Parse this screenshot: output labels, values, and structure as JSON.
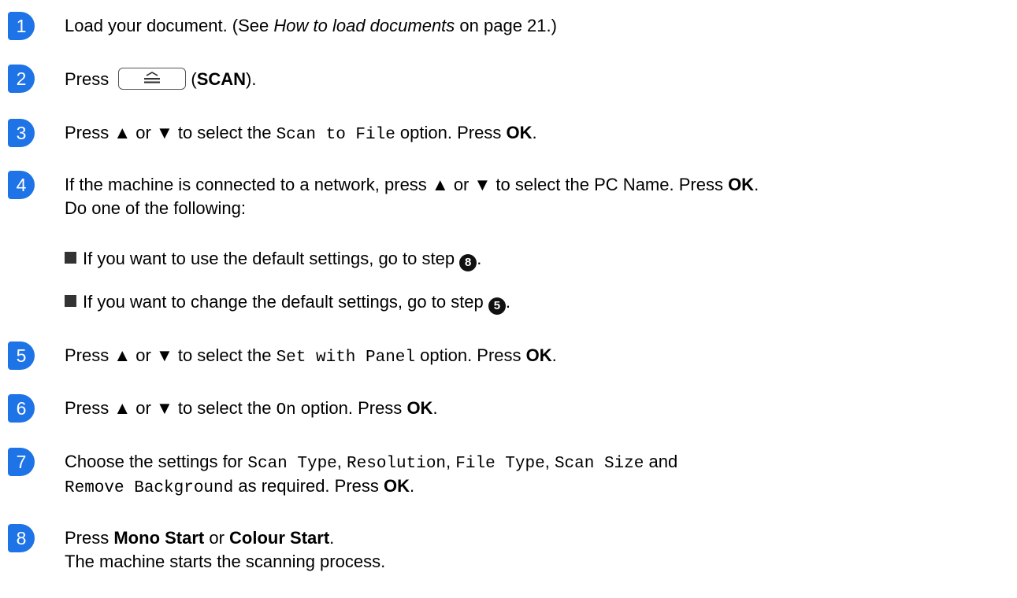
{
  "steps": [
    {
      "num": "1",
      "text_a": "Load your document. (See ",
      "ref_italic": "How to load documents",
      "text_b": " on page 21.)"
    },
    {
      "num": "2",
      "press": "Press",
      "key_label": "SCAN",
      "paren_open": "(",
      "paren_close": ")."
    },
    {
      "num": "3",
      "a": "Press ",
      "up": "▲",
      "or": " or ",
      "down": "▼",
      "b": " to select the ",
      "mono": "Scan to File",
      "c": " option. Press ",
      "ok": "OK",
      "end": "."
    },
    {
      "num": "4",
      "a": "If the machine is connected to a network, press ",
      "up": "▲",
      "or": " or ",
      "down": "▼",
      "b": " to select the PC Name. Press ",
      "ok": "OK",
      "end": ".",
      "line2": "Do one of the following:",
      "bullets": [
        {
          "text": "If you want to use the default settings, go to step ",
          "ref": "8",
          "end": "."
        },
        {
          "text": "If you want to change the default settings, go to step ",
          "ref": "5",
          "end": "."
        }
      ]
    },
    {
      "num": "5",
      "a": "Press ",
      "up": "▲",
      "or": " or ",
      "down": "▼",
      "b": " to select the ",
      "mono": "Set with Panel",
      "c": " option. Press ",
      "ok": "OK",
      "end": "."
    },
    {
      "num": "6",
      "a": "Press ",
      "up": "▲",
      "or": " or ",
      "down": "▼",
      "b": " to select the ",
      "mono": "On",
      "c": " option. Press ",
      "ok": "OK",
      "end": "."
    },
    {
      "num": "7",
      "a": "Choose the settings for ",
      "m1": "Scan Type",
      "s1": ", ",
      "m2": "Resolution",
      "s2": ", ",
      "m3": "File Type",
      "s3": ", ",
      "m4": "Scan Size",
      "s4": " and",
      "m5": "Remove Background",
      "c": " as required. Press ",
      "ok": "OK",
      "end": "."
    },
    {
      "num": "8",
      "a": "Press ",
      "mono_start": "Mono Start",
      "or": " or ",
      "colour_start": "Colour Start",
      "end": ".",
      "line2": "The machine starts the scanning process."
    }
  ],
  "colors": {
    "marker": "#1e73e6"
  },
  "icons": {
    "scan_key": "scan-icon",
    "bullet": "square-bullet-icon"
  }
}
